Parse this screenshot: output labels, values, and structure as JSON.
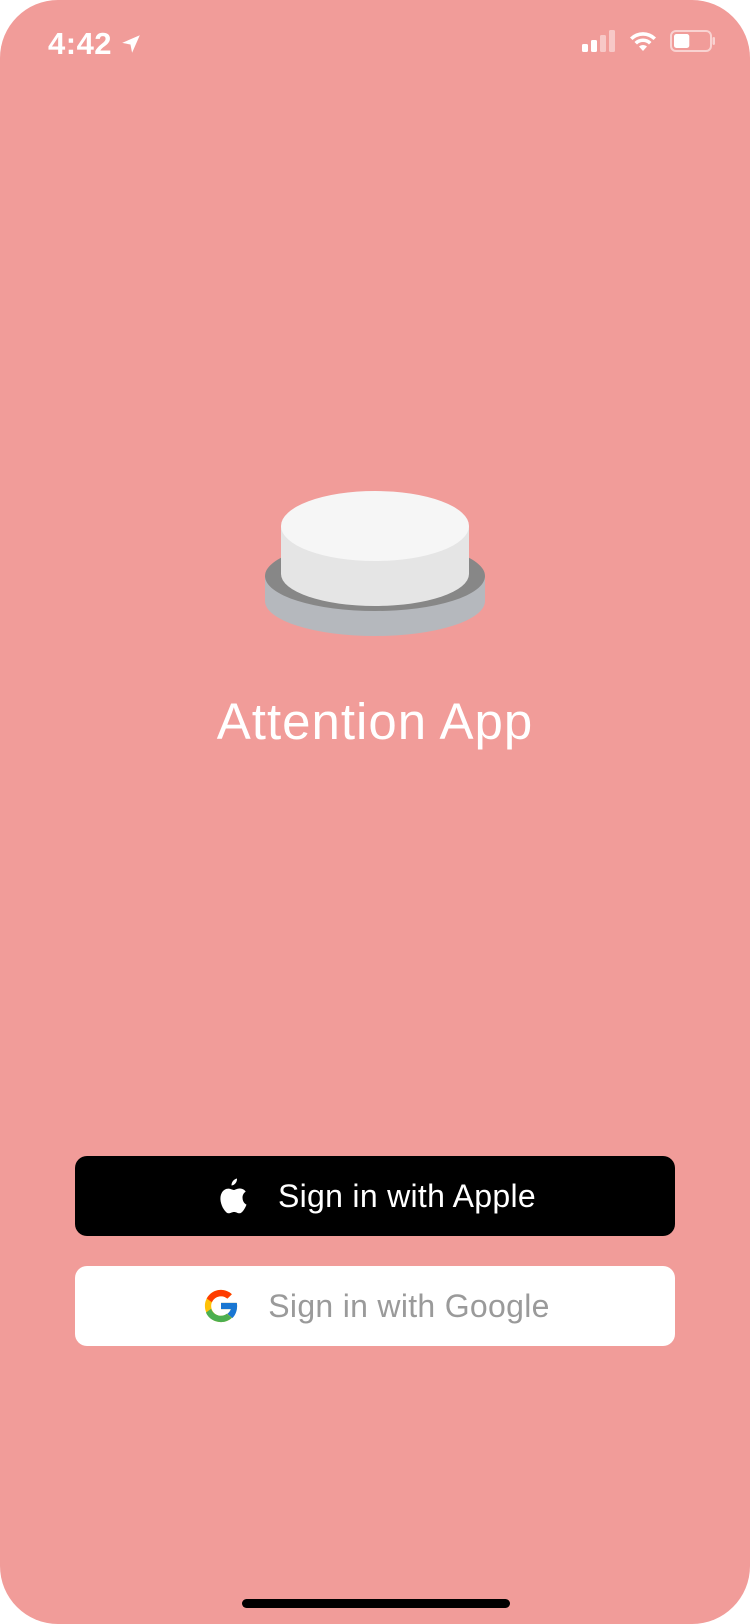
{
  "status_bar": {
    "time": "4:42",
    "location_icon": "location-arrow-icon",
    "signal_icon": "cellular-signal-icon",
    "wifi_icon": "wifi-icon",
    "battery_icon": "battery-icon",
    "battery_level": 0.45
  },
  "app": {
    "logo_icon": "big-button-icon",
    "title": "Attention App",
    "background_color": "#f19c99"
  },
  "auth": {
    "apple_label": "Sign in with Apple",
    "apple_icon": "apple-logo-icon",
    "google_label": "Sign in with Google",
    "google_icon": "google-logo-icon"
  }
}
